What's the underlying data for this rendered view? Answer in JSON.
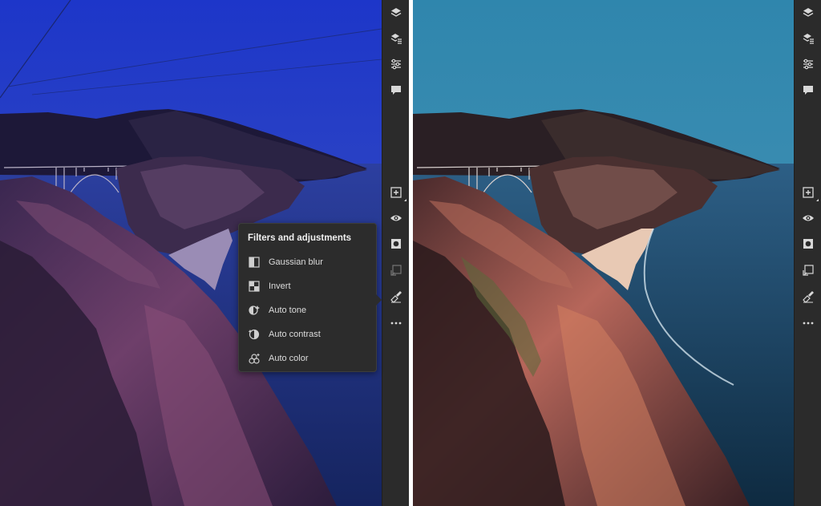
{
  "popup": {
    "title": "Filters and adjustments",
    "items": [
      {
        "label": "Gaussian blur",
        "icon": "gaussian-blur-icon"
      },
      {
        "label": "Invert",
        "icon": "invert-icon"
      },
      {
        "label": "Auto tone",
        "icon": "auto-tone-icon"
      },
      {
        "label": "Auto contrast",
        "icon": "auto-contrast-icon"
      },
      {
        "label": "Auto color",
        "icon": "auto-color-icon"
      }
    ]
  },
  "toolbar": {
    "tools": [
      "layers-icon",
      "layer-properties-icon",
      "adjustments-icon",
      "comments-icon",
      "add-layer-icon",
      "visibility-icon",
      "mask-icon",
      "clip-icon",
      "filters-icon",
      "more-icon"
    ]
  },
  "colors": {
    "toolbar_bg": "#2b2b2b",
    "popup_bg": "#2c2c2c",
    "icon": "#d8d8d8"
  }
}
